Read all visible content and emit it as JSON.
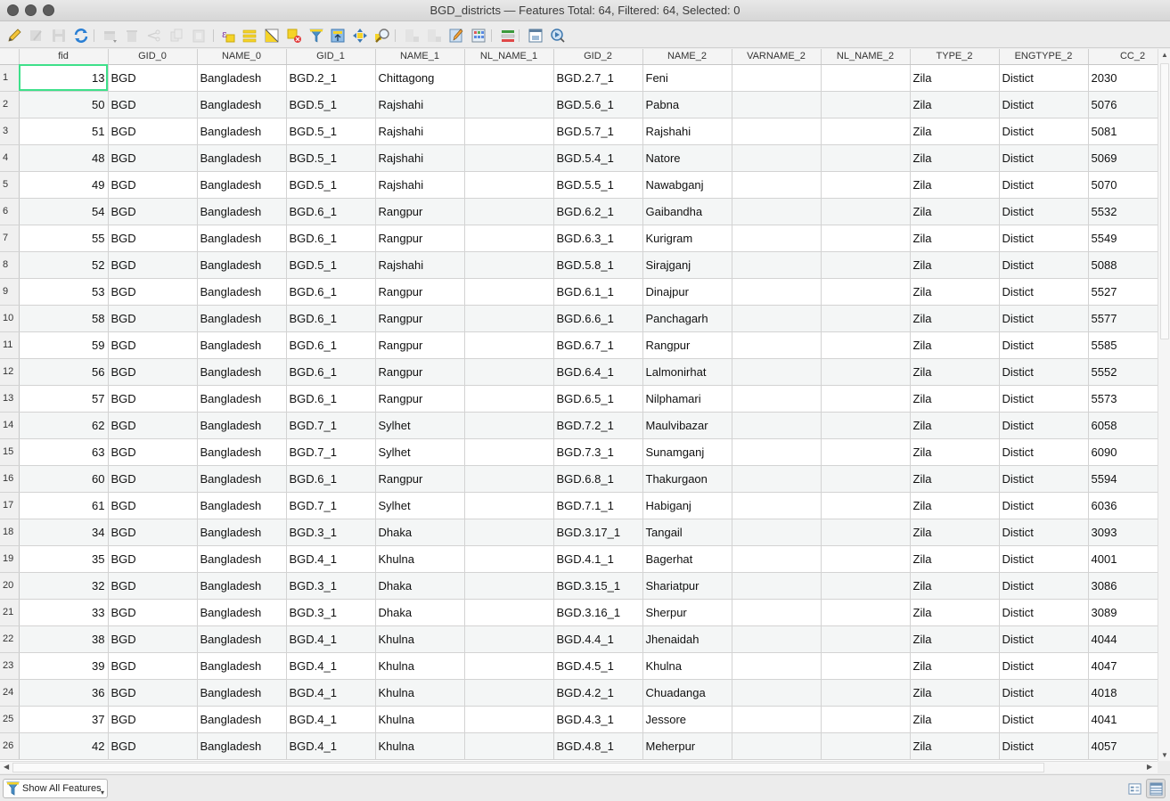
{
  "window": {
    "title": "BGD_districts — Features Total: 64, Filtered: 64, Selected: 0"
  },
  "toolbar": {
    "buttons": [
      {
        "name": "toggle-editing-icon",
        "enabled": true
      },
      {
        "name": "toggle-multi-edit-icon",
        "enabled": false
      },
      {
        "name": "save-edits-icon",
        "enabled": false
      },
      {
        "name": "reload-table-icon",
        "enabled": true
      },
      {
        "name": "add-feature-icon",
        "enabled": false
      },
      {
        "name": "delete-selected-icon",
        "enabled": false
      },
      {
        "name": "cut-icon",
        "enabled": false
      },
      {
        "name": "copy-icon",
        "enabled": false
      },
      {
        "name": "paste-icon",
        "enabled": false
      },
      {
        "name": "select-by-expression-icon",
        "enabled": true
      },
      {
        "name": "select-all-icon",
        "enabled": true
      },
      {
        "name": "invert-selection-icon",
        "enabled": true
      },
      {
        "name": "deselect-all-icon",
        "enabled": true
      },
      {
        "name": "filter-select-icon",
        "enabled": true
      },
      {
        "name": "move-selection-to-top-icon",
        "enabled": true
      },
      {
        "name": "pan-map-to-selected-icon",
        "enabled": true
      },
      {
        "name": "zoom-map-to-selected-icon",
        "enabled": true
      },
      {
        "name": "new-field-icon",
        "enabled": false
      },
      {
        "name": "delete-field-icon",
        "enabled": false
      },
      {
        "name": "conditional-formatting-icon",
        "enabled": true
      },
      {
        "name": "field-calculator-icon",
        "enabled": true
      },
      {
        "name": "organize-columns-icon",
        "enabled": true
      },
      {
        "name": "dock-window-icon",
        "enabled": true
      },
      {
        "name": "actions-icon",
        "enabled": true
      }
    ]
  },
  "table": {
    "columns": [
      "fid",
      "GID_0",
      "NAME_0",
      "GID_1",
      "NAME_1",
      "NL_NAME_1",
      "GID_2",
      "NAME_2",
      "VARNAME_2",
      "NL_NAME_2",
      "TYPE_2",
      "ENGTYPE_2",
      "CC_2"
    ],
    "rows": [
      [
        "13",
        "BGD",
        "Bangladesh",
        "BGD.2_1",
        "Chittagong",
        "",
        "BGD.2.7_1",
        "Feni",
        "",
        "",
        "Zila",
        "Distict",
        "2030"
      ],
      [
        "50",
        "BGD",
        "Bangladesh",
        "BGD.5_1",
        "Rajshahi",
        "",
        "BGD.5.6_1",
        "Pabna",
        "",
        "",
        "Zila",
        "Distict",
        "5076"
      ],
      [
        "51",
        "BGD",
        "Bangladesh",
        "BGD.5_1",
        "Rajshahi",
        "",
        "BGD.5.7_1",
        "Rajshahi",
        "",
        "",
        "Zila",
        "Distict",
        "5081"
      ],
      [
        "48",
        "BGD",
        "Bangladesh",
        "BGD.5_1",
        "Rajshahi",
        "",
        "BGD.5.4_1",
        "Natore",
        "",
        "",
        "Zila",
        "Distict",
        "5069"
      ],
      [
        "49",
        "BGD",
        "Bangladesh",
        "BGD.5_1",
        "Rajshahi",
        "",
        "BGD.5.5_1",
        "Nawabganj",
        "",
        "",
        "Zila",
        "Distict",
        "5070"
      ],
      [
        "54",
        "BGD",
        "Bangladesh",
        "BGD.6_1",
        "Rangpur",
        "",
        "BGD.6.2_1",
        "Gaibandha",
        "",
        "",
        "Zila",
        "Distict",
        "5532"
      ],
      [
        "55",
        "BGD",
        "Bangladesh",
        "BGD.6_1",
        "Rangpur",
        "",
        "BGD.6.3_1",
        "Kurigram",
        "",
        "",
        "Zila",
        "Distict",
        "5549"
      ],
      [
        "52",
        "BGD",
        "Bangladesh",
        "BGD.5_1",
        "Rajshahi",
        "",
        "BGD.5.8_1",
        "Sirajganj",
        "",
        "",
        "Zila",
        "Distict",
        "5088"
      ],
      [
        "53",
        "BGD",
        "Bangladesh",
        "BGD.6_1",
        "Rangpur",
        "",
        "BGD.6.1_1",
        "Dinajpur",
        "",
        "",
        "Zila",
        "Distict",
        "5527"
      ],
      [
        "58",
        "BGD",
        "Bangladesh",
        "BGD.6_1",
        "Rangpur",
        "",
        "BGD.6.6_1",
        "Panchagarh",
        "",
        "",
        "Zila",
        "Distict",
        "5577"
      ],
      [
        "59",
        "BGD",
        "Bangladesh",
        "BGD.6_1",
        "Rangpur",
        "",
        "BGD.6.7_1",
        "Rangpur",
        "",
        "",
        "Zila",
        "Distict",
        "5585"
      ],
      [
        "56",
        "BGD",
        "Bangladesh",
        "BGD.6_1",
        "Rangpur",
        "",
        "BGD.6.4_1",
        "Lalmonirhat",
        "",
        "",
        "Zila",
        "Distict",
        "5552"
      ],
      [
        "57",
        "BGD",
        "Bangladesh",
        "BGD.6_1",
        "Rangpur",
        "",
        "BGD.6.5_1",
        "Nilphamari",
        "",
        "",
        "Zila",
        "Distict",
        "5573"
      ],
      [
        "62",
        "BGD",
        "Bangladesh",
        "BGD.7_1",
        "Sylhet",
        "",
        "BGD.7.2_1",
        "Maulvibazar",
        "",
        "",
        "Zila",
        "Distict",
        "6058"
      ],
      [
        "63",
        "BGD",
        "Bangladesh",
        "BGD.7_1",
        "Sylhet",
        "",
        "BGD.7.3_1",
        "Sunamganj",
        "",
        "",
        "Zila",
        "Distict",
        "6090"
      ],
      [
        "60",
        "BGD",
        "Bangladesh",
        "BGD.6_1",
        "Rangpur",
        "",
        "BGD.6.8_1",
        "Thakurgaon",
        "",
        "",
        "Zila",
        "Distict",
        "5594"
      ],
      [
        "61",
        "BGD",
        "Bangladesh",
        "BGD.7_1",
        "Sylhet",
        "",
        "BGD.7.1_1",
        "Habiganj",
        "",
        "",
        "Zila",
        "Distict",
        "6036"
      ],
      [
        "34",
        "BGD",
        "Bangladesh",
        "BGD.3_1",
        "Dhaka",
        "",
        "BGD.3.17_1",
        "Tangail",
        "",
        "",
        "Zila",
        "Distict",
        "3093"
      ],
      [
        "35",
        "BGD",
        "Bangladesh",
        "BGD.4_1",
        "Khulna",
        "",
        "BGD.4.1_1",
        "Bagerhat",
        "",
        "",
        "Zila",
        "Distict",
        "4001"
      ],
      [
        "32",
        "BGD",
        "Bangladesh",
        "BGD.3_1",
        "Dhaka",
        "",
        "BGD.3.15_1",
        "Shariatpur",
        "",
        "",
        "Zila",
        "Distict",
        "3086"
      ],
      [
        "33",
        "BGD",
        "Bangladesh",
        "BGD.3_1",
        "Dhaka",
        "",
        "BGD.3.16_1",
        "Sherpur",
        "",
        "",
        "Zila",
        "Distict",
        "3089"
      ],
      [
        "38",
        "BGD",
        "Bangladesh",
        "BGD.4_1",
        "Khulna",
        "",
        "BGD.4.4_1",
        "Jhenaidah",
        "",
        "",
        "Zila",
        "Distict",
        "4044"
      ],
      [
        "39",
        "BGD",
        "Bangladesh",
        "BGD.4_1",
        "Khulna",
        "",
        "BGD.4.5_1",
        "Khulna",
        "",
        "",
        "Zila",
        "Distict",
        "4047"
      ],
      [
        "36",
        "BGD",
        "Bangladesh",
        "BGD.4_1",
        "Khulna",
        "",
        "BGD.4.2_1",
        "Chuadanga",
        "",
        "",
        "Zila",
        "Distict",
        "4018"
      ],
      [
        "37",
        "BGD",
        "Bangladesh",
        "BGD.4_1",
        "Khulna",
        "",
        "BGD.4.3_1",
        "Jessore",
        "",
        "",
        "Zila",
        "Distict",
        "4041"
      ],
      [
        "42",
        "BGD",
        "Bangladesh",
        "BGD.4_1",
        "Khulna",
        "",
        "BGD.4.8_1",
        "Meherpur",
        "",
        "",
        "Zila",
        "Distict",
        "4057"
      ]
    ],
    "selected_cell": {
      "row": 0,
      "col": 0
    }
  },
  "bottom": {
    "filter_button_label": "Show All Features",
    "view_modes": [
      {
        "name": "form-view-icon",
        "active": false
      },
      {
        "name": "table-view-icon",
        "active": true
      }
    ]
  },
  "colors": {
    "selected_cell_border": "#3ee08a",
    "alt_row": "#f4f6f6",
    "accent_yellow": "#f5d328",
    "reload_blue": "#2a7fd4"
  }
}
